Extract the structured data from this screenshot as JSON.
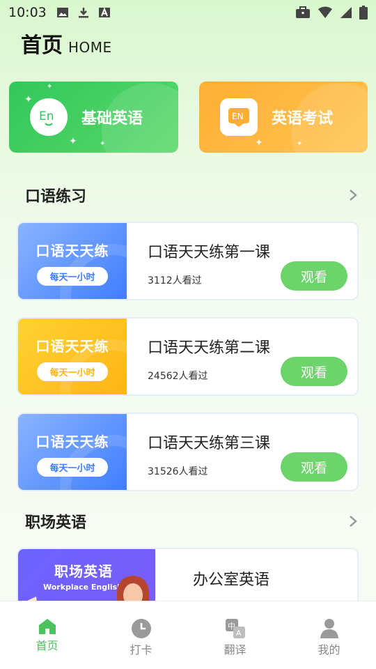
{
  "status_bar": {
    "time": "10:03"
  },
  "header": {
    "title_zh": "首页",
    "title_en": "HOME"
  },
  "features": [
    {
      "label": "基础英语",
      "icon": "en-bubble-icon",
      "color": "#32c75a"
    },
    {
      "label": "英语考试",
      "icon": "en-book-icon",
      "color": "#ffae35"
    }
  ],
  "sections": {
    "speaking": {
      "title": "口语练习"
    },
    "workplace": {
      "title": "职场英语"
    }
  },
  "lessons": [
    {
      "thumb_title": "口语天天练",
      "thumb_pill": "每天一小时",
      "name": "口语天天练第一课",
      "views": "3112人看过",
      "button": "观看",
      "theme": "blue"
    },
    {
      "thumb_title": "口语天天练",
      "thumb_pill": "每天一小时",
      "name": "口语天天练第二课",
      "views": "24562人看过",
      "button": "观看",
      "theme": "yellow"
    },
    {
      "thumb_title": "口语天天练",
      "thumb_pill": "每天一小时",
      "name": "口语天天练第三课",
      "views": "31526人看过",
      "button": "观看",
      "theme": "blue"
    }
  ],
  "workplace_card": {
    "thumb_title": "职场英语",
    "thumb_sub": "Workplace English",
    "name": "办公室英语"
  },
  "nav": [
    {
      "label": "首页",
      "icon": "home-icon",
      "active": true
    },
    {
      "label": "打卡",
      "icon": "clock-icon",
      "active": false
    },
    {
      "label": "翻译",
      "icon": "translate-icon",
      "active": false
    },
    {
      "label": "我的",
      "icon": "user-icon",
      "active": false
    }
  ],
  "colors": {
    "accent_green": "#4cc35f",
    "button_green": "#6dd36b",
    "card_orange": "#ffae35",
    "thumb_blue": "#3f7dff",
    "thumb_yellow": "#ffb414"
  }
}
